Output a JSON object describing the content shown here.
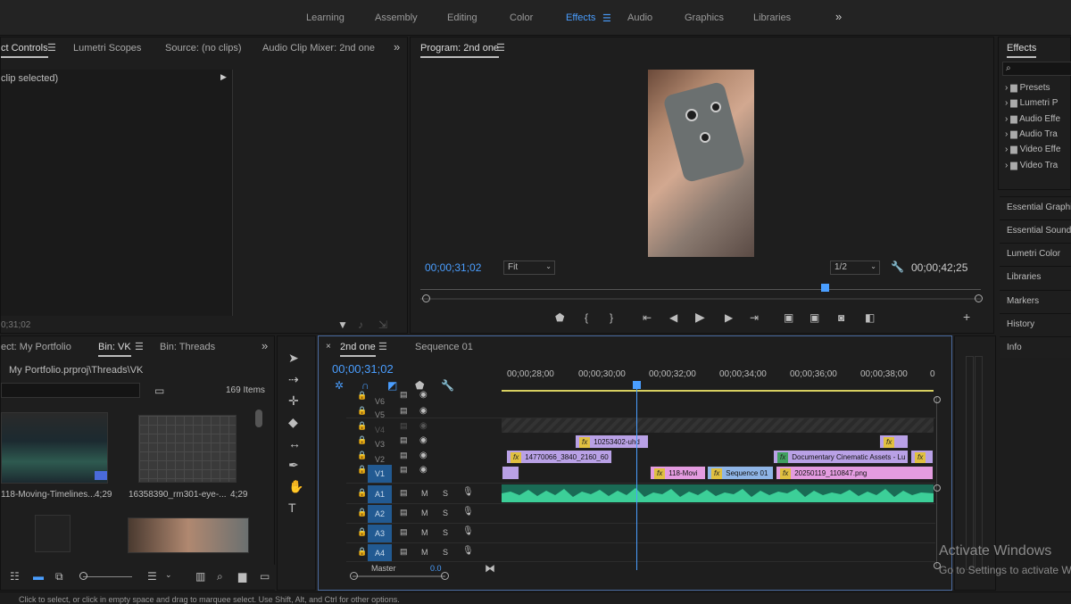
{
  "workspaces": [
    "Learning",
    "Assembly",
    "Editing",
    "Color",
    "Effects",
    "Audio",
    "Graphics",
    "Libraries"
  ],
  "active_workspace": "Effects",
  "source_tabs": [
    "ct Controls",
    "Lumetri Scopes",
    "Source: (no clips)",
    "Audio Clip Mixer: 2nd one"
  ],
  "source": {
    "no_clip": "clip selected)",
    "timecode": "0;31;02"
  },
  "program": {
    "title": "Program: 2nd one",
    "timecode": "00;00;31;02",
    "fit": "Fit",
    "resolution": "1/2",
    "duration": "00;00;42;25"
  },
  "project_tabs": [
    "ect: My Portfolio",
    "Bin: VK",
    "Bin: Threads"
  ],
  "project": {
    "path": "My Portfolio.prproj\\Threads\\VK",
    "items": "169 Items",
    "thumbs": [
      {
        "name": "118-Moving-Timelines...",
        "dur": "4;29"
      },
      {
        "name": "16358390_rm301-eye-...",
        "dur": "4;29"
      }
    ]
  },
  "timeline": {
    "tabs": [
      "2nd one",
      "Sequence 01"
    ],
    "timecode": "00;00;31;02",
    "ruler": [
      "00;00;28;00",
      "00;00;30;00",
      "00;00;32;00",
      "00;00;34;00",
      "00;00;36;00",
      "00;00;38;00",
      "0"
    ],
    "video_tracks": [
      "V6",
      "V5",
      "V4",
      "V3",
      "V2",
      "V1"
    ],
    "audio_tracks": [
      "A1",
      "A2",
      "A3",
      "A4"
    ],
    "master": "Master",
    "master_val": "0.0",
    "clips": {
      "v3a": "10253402-uhd",
      "v2a": "14770066_3840_2160_60",
      "v2b": "Documentary Cinematic Assets - Lu",
      "v1a": "118-Movi",
      "v1b": "Sequence 01",
      "v1c": "20250119_110847.png"
    }
  },
  "effects": {
    "title": "Effects",
    "items": [
      "Presets",
      "Lumetri P",
      "Audio Effe",
      "Audio Tra",
      "Video Effe",
      "Video Tra"
    ]
  },
  "side_panels": [
    "Essential Graphic",
    "Essential Sound",
    "Lumetri Color",
    "Libraries",
    "Markers",
    "History",
    "Info"
  ],
  "activate": {
    "title": "Activate Windows",
    "sub": "Go to Settings to activate W"
  },
  "status": "Click to select, or click in empty space and drag to marquee select. Use Shift, Alt, and Ctrl for other options.",
  "ms": "M",
  "ss": "S"
}
